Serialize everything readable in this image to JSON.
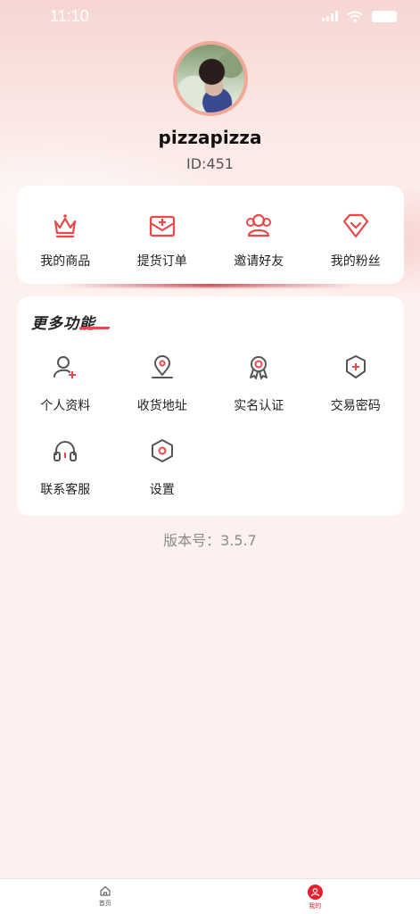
{
  "status_bar": {
    "time": "11:10"
  },
  "profile": {
    "username": "pizzapizza",
    "id_text": "ID:451"
  },
  "main_actions": [
    {
      "label": "我的商品",
      "icon": "crown-icon"
    },
    {
      "label": "提货订单",
      "icon": "order-envelope-icon"
    },
    {
      "label": "邀请好友",
      "icon": "invite-friends-icon"
    },
    {
      "label": "我的粉丝",
      "icon": "diamond-heart-icon"
    }
  ],
  "more": {
    "title": "更多功能",
    "items": [
      {
        "label": "个人资料",
        "icon": "user-profile-icon"
      },
      {
        "label": "收货地址",
        "icon": "location-pin-icon"
      },
      {
        "label": "实名认证",
        "icon": "certificate-badge-icon"
      },
      {
        "label": "交易密码",
        "icon": "shield-plus-icon"
      },
      {
        "label": "联系客服",
        "icon": "headset-icon"
      },
      {
        "label": "设置",
        "icon": "settings-hexagon-icon"
      }
    ]
  },
  "version": "版本号：3.5.7",
  "tabbar": {
    "items": [
      {
        "label": "首页",
        "icon": "home-icon",
        "active": false
      },
      {
        "label": "我的",
        "icon": "profile-icon",
        "active": true
      }
    ]
  },
  "colors": {
    "accent": "#e8202e",
    "icon_red": "#e84a4a",
    "icon_gray": "#555555"
  }
}
